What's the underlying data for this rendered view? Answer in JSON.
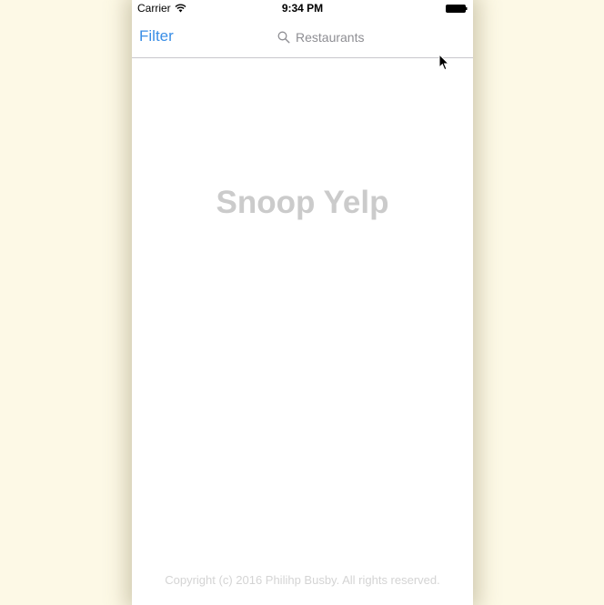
{
  "status_bar": {
    "carrier": "Carrier",
    "time": "9:34 PM",
    "wifi_icon": "wifi-icon",
    "battery_icon": "battery-icon"
  },
  "nav": {
    "filter_label": "Filter",
    "search_placeholder": "Restaurants",
    "search_icon": "search-icon"
  },
  "main": {
    "title": "Snoop Yelp",
    "copyright": "Copyright (c) 2016 Philihp Busby. All rights reserved."
  },
  "colors": {
    "background": "#fdf9e6",
    "accent": "#3a8ee6",
    "title_text": "#cbcbcb",
    "muted_text": "#d4d4d4"
  }
}
